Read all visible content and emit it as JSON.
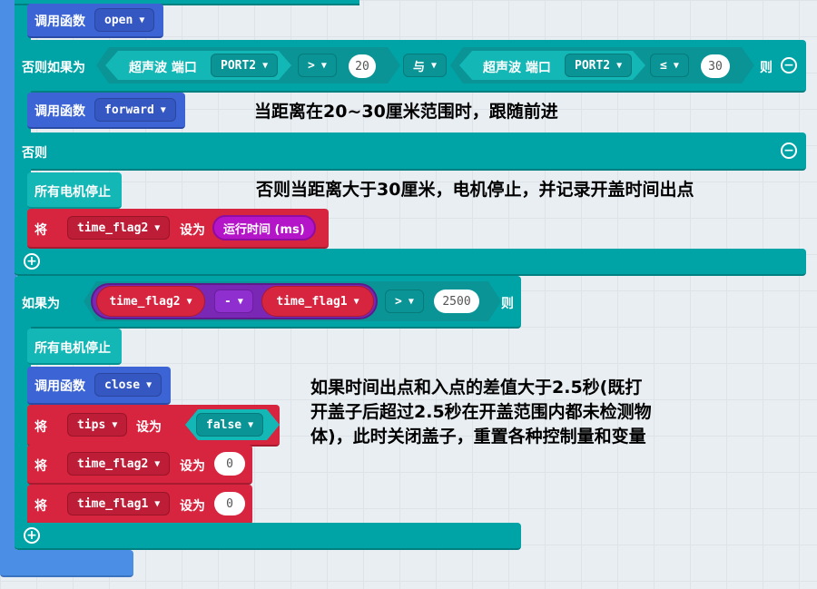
{
  "blocks": {
    "call_open": {
      "label": "调用函数",
      "func": "open"
    },
    "else_if": {
      "label": "否则如果为",
      "sensor1": {
        "label": "超声波 端口",
        "port": "PORT2",
        "op": ">",
        "value": "20"
      },
      "logic": "与",
      "sensor2": {
        "label": "超声波 端口",
        "port": "PORT2",
        "op": "≤",
        "value": "30"
      },
      "then": "则"
    },
    "call_forward": {
      "label": "调用函数",
      "func": "forward"
    },
    "else": {
      "label": "否则"
    },
    "stop1": {
      "label": "所有电机停止"
    },
    "set_flag2_time": {
      "set": "将",
      "var": "time_flag2",
      "to": "设为",
      "value": "运行时间 (ms)"
    },
    "if2": {
      "label": "如果为",
      "left": "time_flag2",
      "minus": "-",
      "right": "time_flag1",
      "op": ">",
      "value": "2500",
      "then": "则"
    },
    "stop2": {
      "label": "所有电机停止"
    },
    "call_close": {
      "label": "调用函数",
      "func": "close"
    },
    "set_tips": {
      "set": "将",
      "var": "tips",
      "to": "设为",
      "value": "false"
    },
    "set_flag2_zero": {
      "set": "将",
      "var": "time_flag2",
      "to": "设为",
      "value": "0"
    },
    "set_flag1_zero": {
      "set": "将",
      "var": "time_flag1",
      "to": "设为",
      "value": "0"
    }
  },
  "notes": {
    "note1": "当距离在20~30厘米范围时，跟随前进",
    "note2": "否则当距离大于30厘米，电机停止，并记录开盖时间出点",
    "note3_line1": "如果时间出点和入点的差值大于2.5秒(既打",
    "note3_line2": "开盖子后超过2.5秒在开盖范围内都未检测物",
    "note3_line3": "体)，此时关闭盖子，重置各种控制量和变量"
  },
  "icons": {
    "collapse": "minus-circle-icon",
    "expand": "plus-circle-icon",
    "dropdown": "triangle-down-icon"
  },
  "colors": {
    "teal": "#00a4a6",
    "blue": "#3c64d4",
    "red": "#d7243f",
    "magenta": "#b515c9",
    "purple": "#7b27b5"
  }
}
